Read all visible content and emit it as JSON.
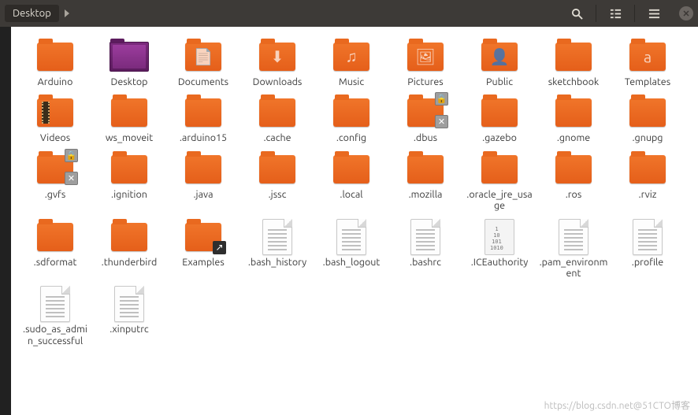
{
  "breadcrumb": {
    "current": "Desktop"
  },
  "items": [
    {
      "label": "Arduino",
      "type": "folder"
    },
    {
      "label": "Desktop",
      "type": "folder-purple"
    },
    {
      "label": "Documents",
      "type": "folder",
      "emblem": "📄"
    },
    {
      "label": "Downloads",
      "type": "folder",
      "emblem": "⬇"
    },
    {
      "label": "Music",
      "type": "folder",
      "emblem": "♫"
    },
    {
      "label": "Pictures",
      "type": "folder",
      "emblem": "🖼"
    },
    {
      "label": "Public",
      "type": "folder",
      "emblem": "👤"
    },
    {
      "label": "sketchbook",
      "type": "folder"
    },
    {
      "label": "Templates",
      "type": "folder",
      "emblem": "a"
    },
    {
      "label": "Videos",
      "type": "folder-video"
    },
    {
      "label": "ws_moveit",
      "type": "folder"
    },
    {
      "label": ".arduino15",
      "type": "folder"
    },
    {
      "label": ".cache",
      "type": "folder"
    },
    {
      "label": ".config",
      "type": "folder"
    },
    {
      "label": ".dbus",
      "type": "folder",
      "locked": true,
      "unreadable": true
    },
    {
      "label": ".gazebo",
      "type": "folder"
    },
    {
      "label": ".gnome",
      "type": "folder"
    },
    {
      "label": ".gnupg",
      "type": "folder"
    },
    {
      "label": ".gvfs",
      "type": "folder",
      "locked": true,
      "unreadable": true
    },
    {
      "label": ".ignition",
      "type": "folder"
    },
    {
      "label": ".java",
      "type": "folder"
    },
    {
      "label": ".jssc",
      "type": "folder"
    },
    {
      "label": ".local",
      "type": "folder"
    },
    {
      "label": ".mozilla",
      "type": "folder"
    },
    {
      "label": ".oracle_jre_usage",
      "type": "folder"
    },
    {
      "label": ".ros",
      "type": "folder"
    },
    {
      "label": ".rviz",
      "type": "folder"
    },
    {
      "label": ".sdformat",
      "type": "folder"
    },
    {
      "label": ".thunderbird",
      "type": "folder"
    },
    {
      "label": "Examples",
      "type": "folder",
      "link": true
    },
    {
      "label": ".bash_history",
      "type": "textfile"
    },
    {
      "label": ".bash_logout",
      "type": "textfile"
    },
    {
      "label": ".bashrc",
      "type": "textfile"
    },
    {
      "label": ".ICEauthority",
      "type": "binfile"
    },
    {
      "label": ".pam_environment",
      "type": "textfile"
    },
    {
      "label": ".profile",
      "type": "textfile"
    },
    {
      "label": ".sudo_as_admin_successful",
      "type": "textfile"
    },
    {
      "label": ".xinputrc",
      "type": "textfile"
    }
  ],
  "watermark": "https://blog.csdn.net@51CTO博客"
}
